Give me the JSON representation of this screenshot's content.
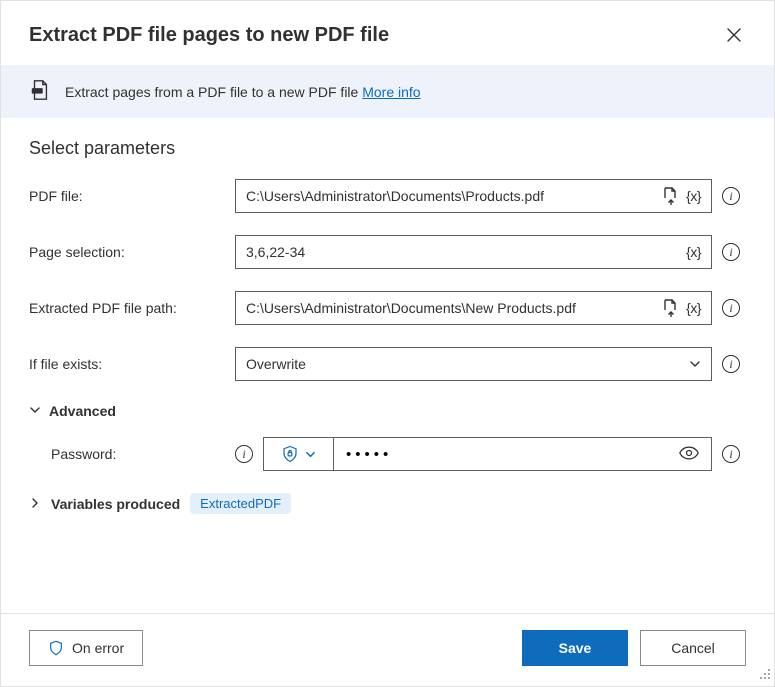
{
  "header": {
    "title": "Extract PDF file pages to new PDF file"
  },
  "banner": {
    "text": "Extract pages from a PDF file to a new PDF file ",
    "more_info": "More info"
  },
  "section_title": "Select parameters",
  "fields": {
    "pdf_file": {
      "label": "PDF file:",
      "value": "C:\\Users\\Administrator\\Documents\\Products.pdf"
    },
    "page_selection": {
      "label": "Page selection:",
      "value": "3,6,22-34"
    },
    "extracted_path": {
      "label": "Extracted PDF file path:",
      "value": "C:\\Users\\Administrator\\Documents\\New Products.pdf"
    },
    "if_exists": {
      "label": "If file exists:",
      "value": "Overwrite"
    }
  },
  "advanced": {
    "label": "Advanced",
    "password_label": "Password:",
    "password_value": "•••••"
  },
  "variables": {
    "label": "Variables produced",
    "badge": "ExtractedPDF"
  },
  "footer": {
    "on_error": "On error",
    "save": "Save",
    "cancel": "Cancel"
  },
  "tokens": {
    "variable_picker": "{x}"
  }
}
